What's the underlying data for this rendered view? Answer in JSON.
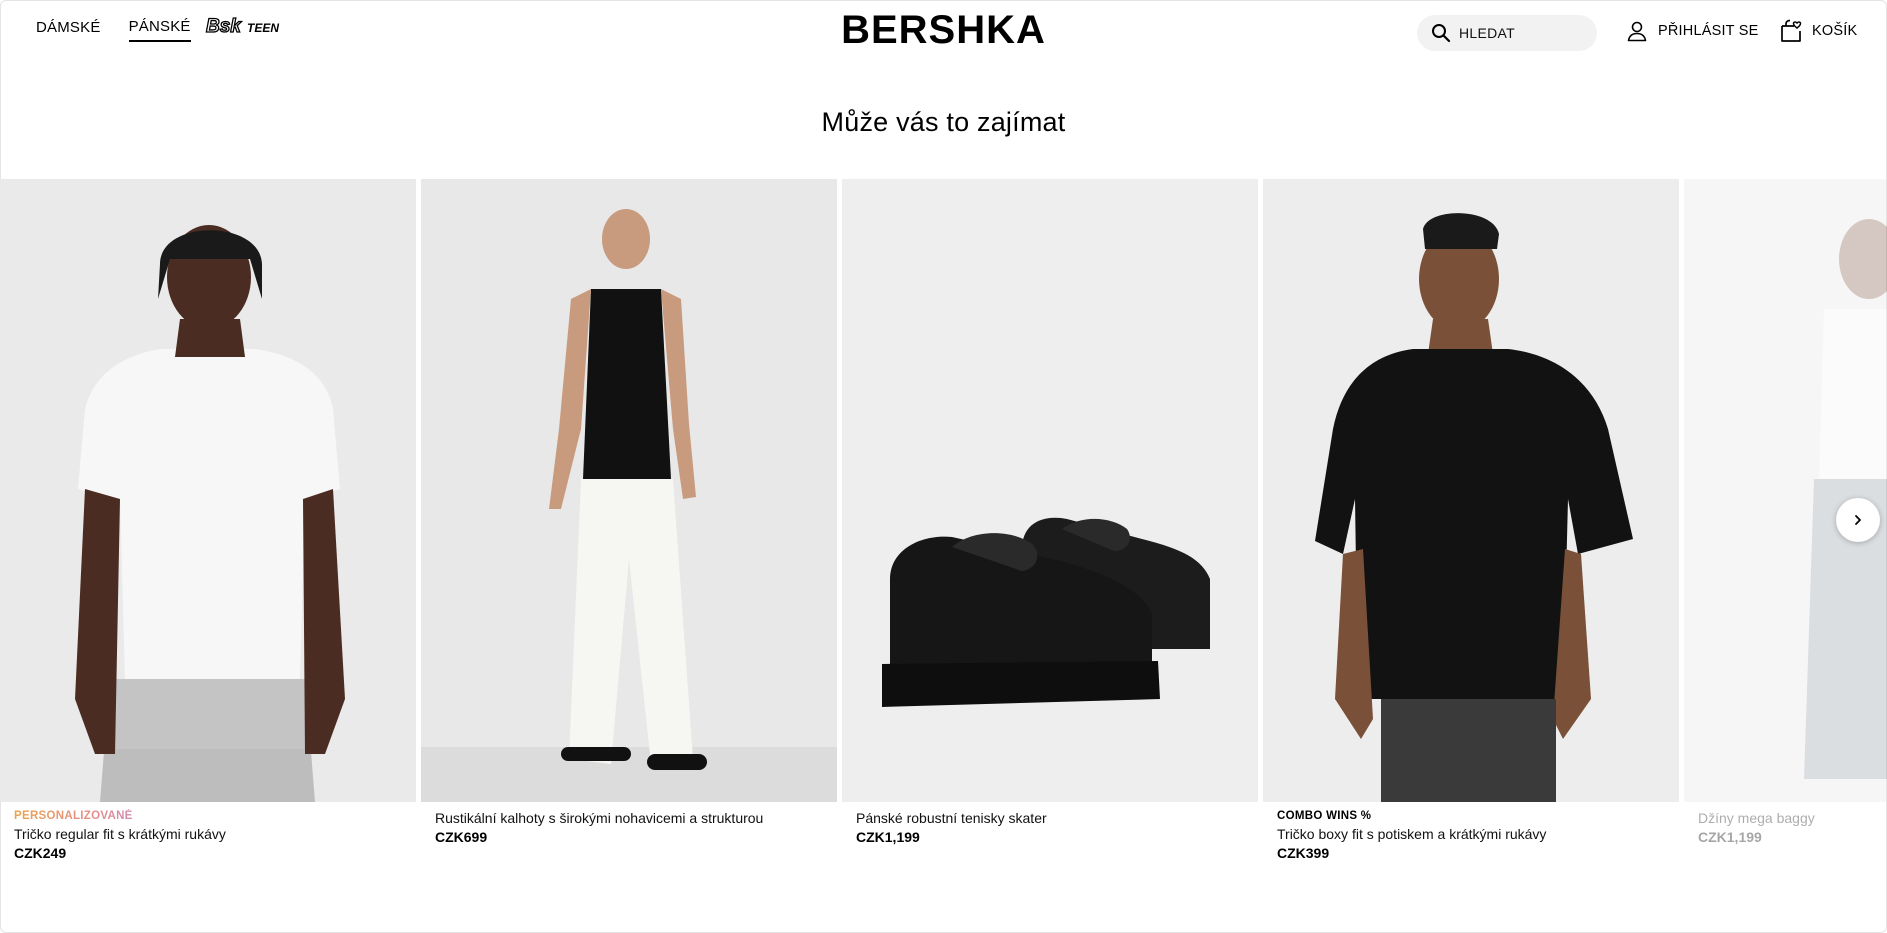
{
  "nav": {
    "women": "DÁMSKÉ",
    "men": "PÁNSKÉ",
    "teen_logo": "BskTEEN"
  },
  "brand": "BERSHKA",
  "header": {
    "search_label": "HLEDAT",
    "login_label": "PŘIHLÁSIT SE",
    "cart_label": "KOŠÍK"
  },
  "section_title": "Může vás to zajímat",
  "products": [
    {
      "badge": "PERSONALIZOVANÉ",
      "name": "Tričko regular fit s krátkými rukávy",
      "price": "CZK249",
      "image": "white-tshirt-model"
    },
    {
      "badge": "",
      "name": "Rustikální kalhoty s širokými nohavicemi a strukturou",
      "price": "CZK699",
      "image": "white-trousers-tank-model"
    },
    {
      "badge": "",
      "name": "Pánské robustní tenisky skater",
      "price": "CZK1,199",
      "image": "black-skater-sneakers"
    },
    {
      "badge": "COMBO WINS %",
      "name": "Tričko boxy fit s potiskem a krátkými rukávy",
      "price": "CZK399",
      "image": "black-boxy-tshirt-model"
    },
    {
      "badge": "",
      "name": "Džíny mega baggy",
      "price": "CZK1,199",
      "image": "mega-baggy-jeans-model"
    }
  ],
  "colors": {
    "accent": "#000000",
    "search_bg": "#f2f2f2",
    "image_bg": "#ebebeb"
  }
}
